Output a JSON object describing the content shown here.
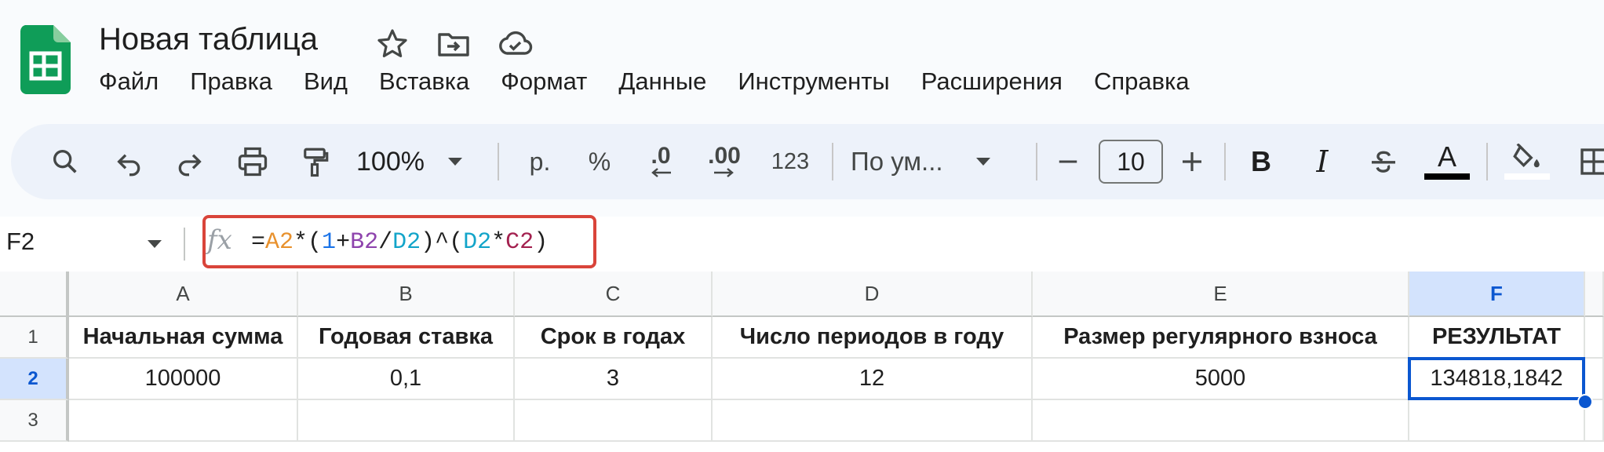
{
  "app": {
    "doc_title": "Новая таблица",
    "brand_color": "#0f9d58",
    "accent_color": "#0b57d0",
    "highlight_color": "#d9443a"
  },
  "menu": [
    "Файл",
    "Правка",
    "Вид",
    "Вставка",
    "Формат",
    "Данные",
    "Инструменты",
    "Расширения",
    "Справка"
  ],
  "toolbar": {
    "zoom": "100%",
    "currency": "р.",
    "percent": "%",
    "dec_decrease": ".0",
    "dec_increase": ".00",
    "number_format": "123",
    "font": "По ум...",
    "font_size": "10",
    "bold": "B",
    "italic": "I",
    "text_color_letter": "A"
  },
  "formula_bar": {
    "cell_ref": "F2",
    "formula_parts": [
      {
        "t": "=",
        "c": "#1f1f1f"
      },
      {
        "t": "A2",
        "c": "#e8912d"
      },
      {
        "t": "*(",
        "c": "#1f1f1f"
      },
      {
        "t": "1",
        "c": "#1a73e8"
      },
      {
        "t": "+",
        "c": "#1f1f1f"
      },
      {
        "t": "B2",
        "c": "#8e44ad"
      },
      {
        "t": "/",
        "c": "#1f1f1f"
      },
      {
        "t": "D2",
        "c": "#12a4c9"
      },
      {
        "t": ")^(",
        "c": "#1f1f1f"
      },
      {
        "t": "D2",
        "c": "#12a4c9"
      },
      {
        "t": "*",
        "c": "#1f1f1f"
      },
      {
        "t": "C2",
        "c": "#a3214f"
      },
      {
        "t": ")",
        "c": "#1f1f1f"
      }
    ]
  },
  "sheet": {
    "columns": [
      "A",
      "B",
      "C",
      "D",
      "E",
      "F"
    ],
    "rows": [
      [
        "Начальная сумма",
        "Годовая ставка",
        "Срок в годах",
        "Число периодов в году",
        "Размер регулярного взноса",
        "РЕЗУЛЬТАТ"
      ],
      [
        "100000",
        "0,1",
        "3",
        "12",
        "5000",
        "134818,1842"
      ],
      [
        "",
        "",
        "",
        "",
        "",
        ""
      ]
    ],
    "row_numbers": [
      "1",
      "2",
      "3"
    ]
  }
}
